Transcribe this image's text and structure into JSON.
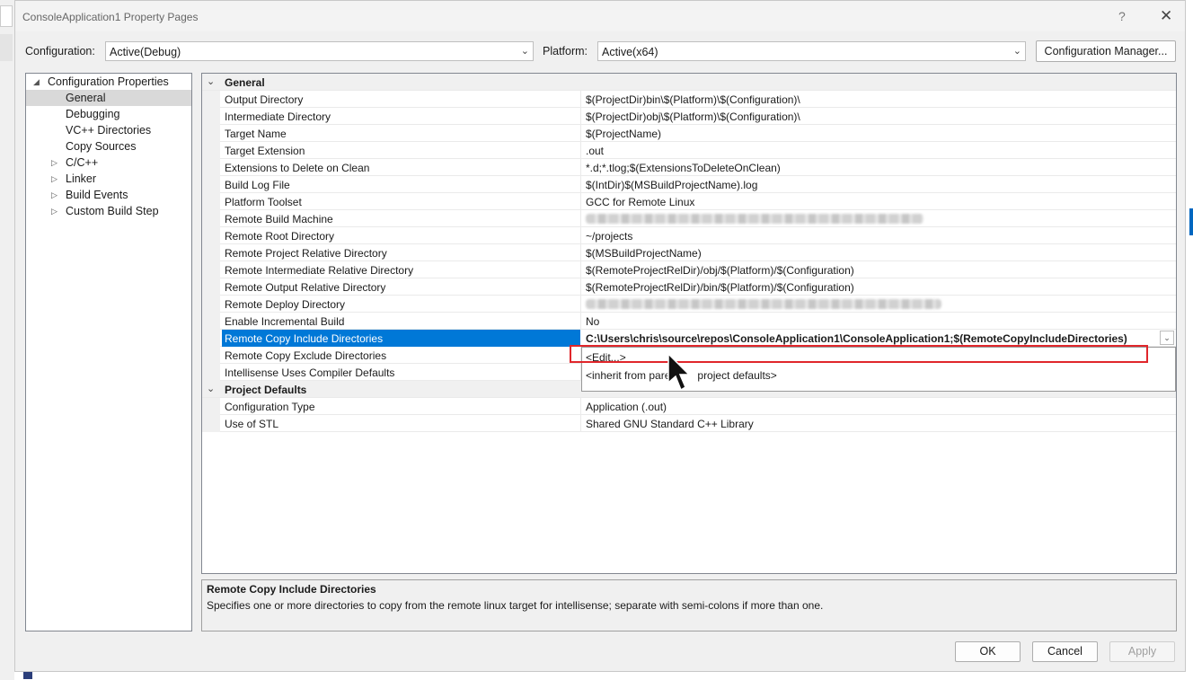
{
  "window": {
    "title": "ConsoleApplication1 Property Pages",
    "help_glyph": "?",
    "close_glyph": "✕"
  },
  "toolbar": {
    "configuration_label": "Configuration:",
    "configuration_value": "Active(Debug)",
    "platform_label": "Platform:",
    "platform_value": "Active(x64)",
    "config_manager_label": "Configuration Manager..."
  },
  "tree": {
    "items": [
      {
        "label": "Configuration Properties",
        "expander": "◢"
      },
      {
        "label": "General"
      },
      {
        "label": "Debugging"
      },
      {
        "label": "VC++ Directories"
      },
      {
        "label": "Copy Sources"
      },
      {
        "label": "C/C++",
        "expander": "▷"
      },
      {
        "label": "Linker",
        "expander": "▷"
      },
      {
        "label": "Build Events",
        "expander": "▷"
      },
      {
        "label": "Custom Build Step",
        "expander": "▷"
      }
    ]
  },
  "grid": {
    "general_category": "General",
    "rows": [
      {
        "name": "Output Directory",
        "value": "$(ProjectDir)bin\\$(Platform)\\$(Configuration)\\"
      },
      {
        "name": "Intermediate Directory",
        "value": "$(ProjectDir)obj\\$(Platform)\\$(Configuration)\\"
      },
      {
        "name": "Target Name",
        "value": "$(ProjectName)"
      },
      {
        "name": "Target Extension",
        "value": ".out"
      },
      {
        "name": "Extensions to Delete on Clean",
        "value": "*.d;*.tlog;$(ExtensionsToDeleteOnClean)"
      },
      {
        "name": "Build Log File",
        "value": "$(IntDir)$(MSBuildProjectName).log"
      },
      {
        "name": "Platform Toolset",
        "value": "GCC for Remote Linux"
      },
      {
        "name": "Remote Build Machine",
        "value": ""
      },
      {
        "name": "Remote Root Directory",
        "value": "~/projects"
      },
      {
        "name": "Remote Project Relative Directory",
        "value": "$(MSBuildProjectName)"
      },
      {
        "name": "Remote Intermediate Relative Directory",
        "value": "$(RemoteProjectRelDir)/obj/$(Platform)/$(Configuration)"
      },
      {
        "name": "Remote Output Relative Directory",
        "value": "$(RemoteProjectRelDir)/bin/$(Platform)/$(Configuration)"
      },
      {
        "name": "Remote Deploy Directory",
        "value": ""
      },
      {
        "name": "Enable Incremental Build",
        "value": "No"
      },
      {
        "name": "Remote Copy Include Directories",
        "value": "C:\\Users\\chris\\source\\repos\\ConsoleApplication1\\ConsoleApplication1;$(RemoteCopyIncludeDirectories)"
      },
      {
        "name": "Remote Copy Exclude Directories",
        "value": ""
      },
      {
        "name": "Intellisense Uses Compiler Defaults",
        "value": ""
      }
    ],
    "project_defaults_category": "Project Defaults",
    "project_rows": [
      {
        "name": "Configuration Type",
        "value": "Application (.out)"
      },
      {
        "name": "Use of STL",
        "value": "Shared GNU Standard C++ Library"
      }
    ],
    "dropdown_options": [
      "<Edit...>",
      "<inherit from parent or project defaults>"
    ],
    "dropdown_option2_visible_a": "<inherit from pare",
    "dropdown_option2_visible_b": "project defaults>"
  },
  "description": {
    "title": "Remote Copy Include Directories",
    "text": "Specifies one or more directories to copy from the remote linux target for intellisense; separate with semi-colons if more than one."
  },
  "buttons": {
    "ok": "OK",
    "cancel": "Cancel",
    "apply": "Apply"
  },
  "colors": {
    "selection": "#0078d7",
    "highlight_box": "#e0262b"
  }
}
